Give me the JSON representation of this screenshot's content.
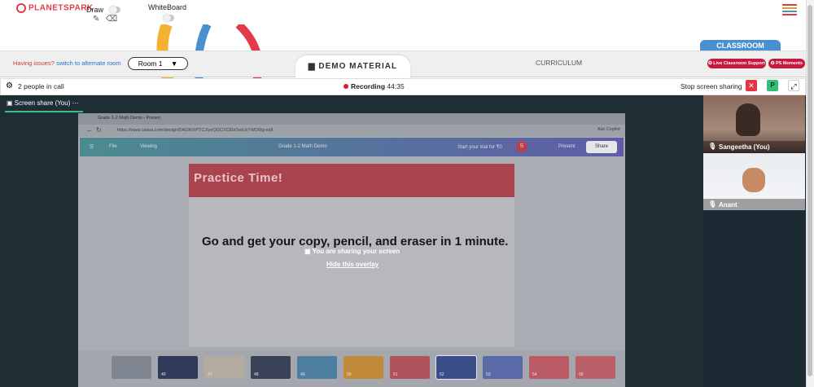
{
  "brand": {
    "name": "PLANETSPARK"
  },
  "toolbar": {
    "draw_label": "Draw",
    "whiteboard_label": "WhiteBoard",
    "pencil_icon": "pencil-icon",
    "eraser_icon": "eraser-icon"
  },
  "header": {
    "issues_text": "Having issues?",
    "alternate_room_link": "switch to alternate room",
    "room_select_value": "Room 1",
    "demo_material_tab": "DEMO MATERIAL",
    "curriculum_tab": "CURRICULUM",
    "classroom_label": "CLASSROOM",
    "live_support_button": "Live Classroom Support",
    "ps_moments_button": "PS Moments"
  },
  "callbar": {
    "people_count_text": "2 people in call",
    "recording_label": "Recording",
    "recording_time": "44:35",
    "stop_sharing_label": "Stop screen sharing",
    "p_button_label": "P"
  },
  "screen_share": {
    "tab_label": "Screen share (You)",
    "overlay_message": "You are sharing your screen",
    "hide_overlay_link": "Hide this overlay",
    "browser": {
      "tab_title": "Grade 1-2 Math Demo - Presen",
      "url": "https://www.canva.com/design/DAGKtXPTCJ/yeQGCXCEhOvnLkYWD6fg-edit",
      "ask_copilot": "Ask Copilot"
    },
    "canva": {
      "file_menu": "File",
      "viewing_menu": "Viewing",
      "doc_title": "Grade 1-2 Math Demo",
      "trial_text": "Start your trial for ₹0",
      "avatar_initial": "S",
      "present_button": "Present",
      "share_button": "Share"
    },
    "slide": {
      "title": "Practice Time!",
      "body": "Go and get your copy, pencil, and eraser in 1 minute."
    },
    "thumbnails": [
      "",
      "40",
      "47",
      "48",
      "49",
      "50",
      "51",
      "52",
      "53",
      "54",
      "55"
    ]
  },
  "participants": [
    {
      "name": "Sangeetha (You)"
    },
    {
      "name": "Anant"
    }
  ],
  "colors": {
    "accent_red": "#c7183e",
    "classroom_blue": "#4a8fd0",
    "recording_red": "#d42030",
    "share_green": "#3fbf7f"
  }
}
